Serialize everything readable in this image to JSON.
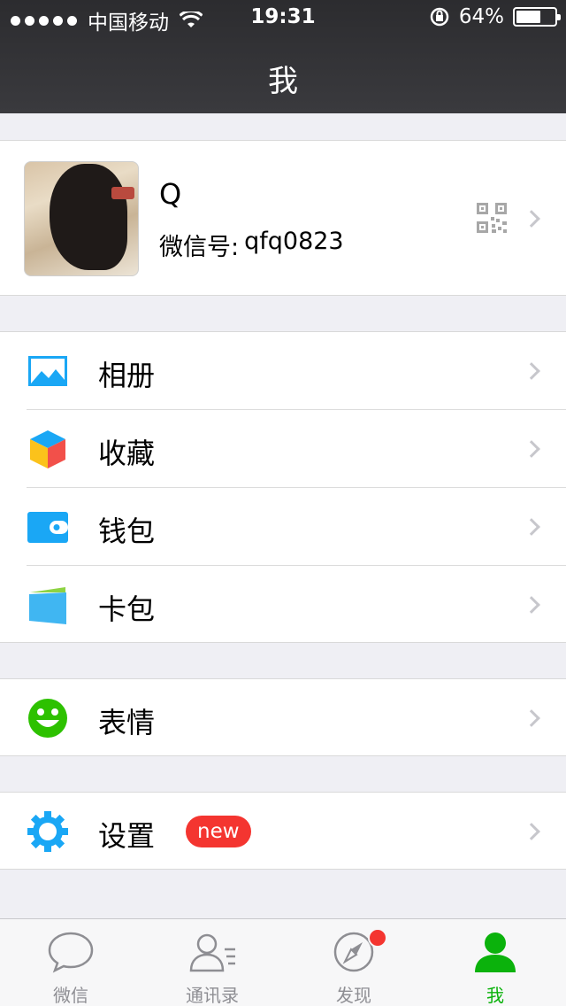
{
  "status_bar": {
    "carrier": "中国移动",
    "time": "19:31",
    "battery_percent": "64%",
    "battery_level": 0.64
  },
  "header": {
    "title": "我"
  },
  "profile": {
    "name": "Q",
    "wechat_id_label": "微信号:",
    "wechat_id": "qfq0823"
  },
  "menu": {
    "album": "相册",
    "favorites": "收藏",
    "wallet": "钱包",
    "card_package": "卡包",
    "stickers": "表情",
    "settings": "设置",
    "settings_badge": "new"
  },
  "tabbar": {
    "tabs": [
      {
        "label": "微信",
        "icon": "chat-bubble-icon"
      },
      {
        "label": "通讯录",
        "icon": "contacts-icon"
      },
      {
        "label": "发现",
        "icon": "compass-icon"
      },
      {
        "label": "我",
        "icon": "person-icon"
      }
    ],
    "active_color": "#0bb20c",
    "inactive_color": "#8e8e93"
  },
  "colors": {
    "badge_red": "#f43530",
    "accent_blue": "#1aa7f5",
    "accent_green": "#2dc100"
  }
}
